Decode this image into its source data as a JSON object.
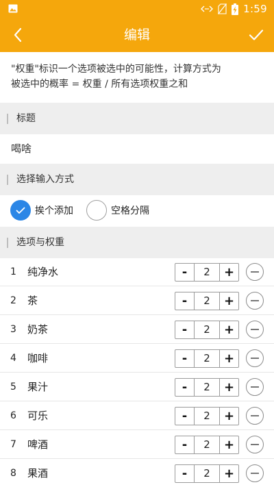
{
  "status_bar": {
    "time": "1:59",
    "icons": [
      "image-icon",
      "data-arrows-icon",
      "no-sim-icon",
      "battery-charging-icon"
    ]
  },
  "app_bar": {
    "title": "编辑",
    "back_icon": "back-arrow-icon",
    "confirm_icon": "check-icon"
  },
  "description": {
    "line1": "\"权重\"标识一个选项被选中的可能性，计算方式为",
    "line2": "被选中的概率 = 权重 / 所有选项权重之和"
  },
  "sections": {
    "title_header": "标题",
    "input_method_header": "选择输入方式",
    "options_header": "选项与权重"
  },
  "title_value": "喝啥",
  "input_method": {
    "options": [
      {
        "label": "挨个添加",
        "selected": true
      },
      {
        "label": "空格分隔",
        "selected": false
      }
    ]
  },
  "stepper_labels": {
    "minus": "-",
    "plus": "+"
  },
  "items": [
    {
      "index": "1",
      "name": "纯净水",
      "weight": "2"
    },
    {
      "index": "2",
      "name": "茶",
      "weight": "2"
    },
    {
      "index": "3",
      "name": "奶茶",
      "weight": "2"
    },
    {
      "index": "4",
      "name": "咖啡",
      "weight": "2"
    },
    {
      "index": "5",
      "name": "果汁",
      "weight": "2"
    },
    {
      "index": "6",
      "name": "可乐",
      "weight": "2"
    },
    {
      "index": "7",
      "name": "啤酒",
      "weight": "2"
    },
    {
      "index": "8",
      "name": "果酒",
      "weight": "2"
    }
  ],
  "colors": {
    "accent": "#f5a70c",
    "radio_selected": "#2b86e6",
    "section_bg": "#eeeeee"
  }
}
